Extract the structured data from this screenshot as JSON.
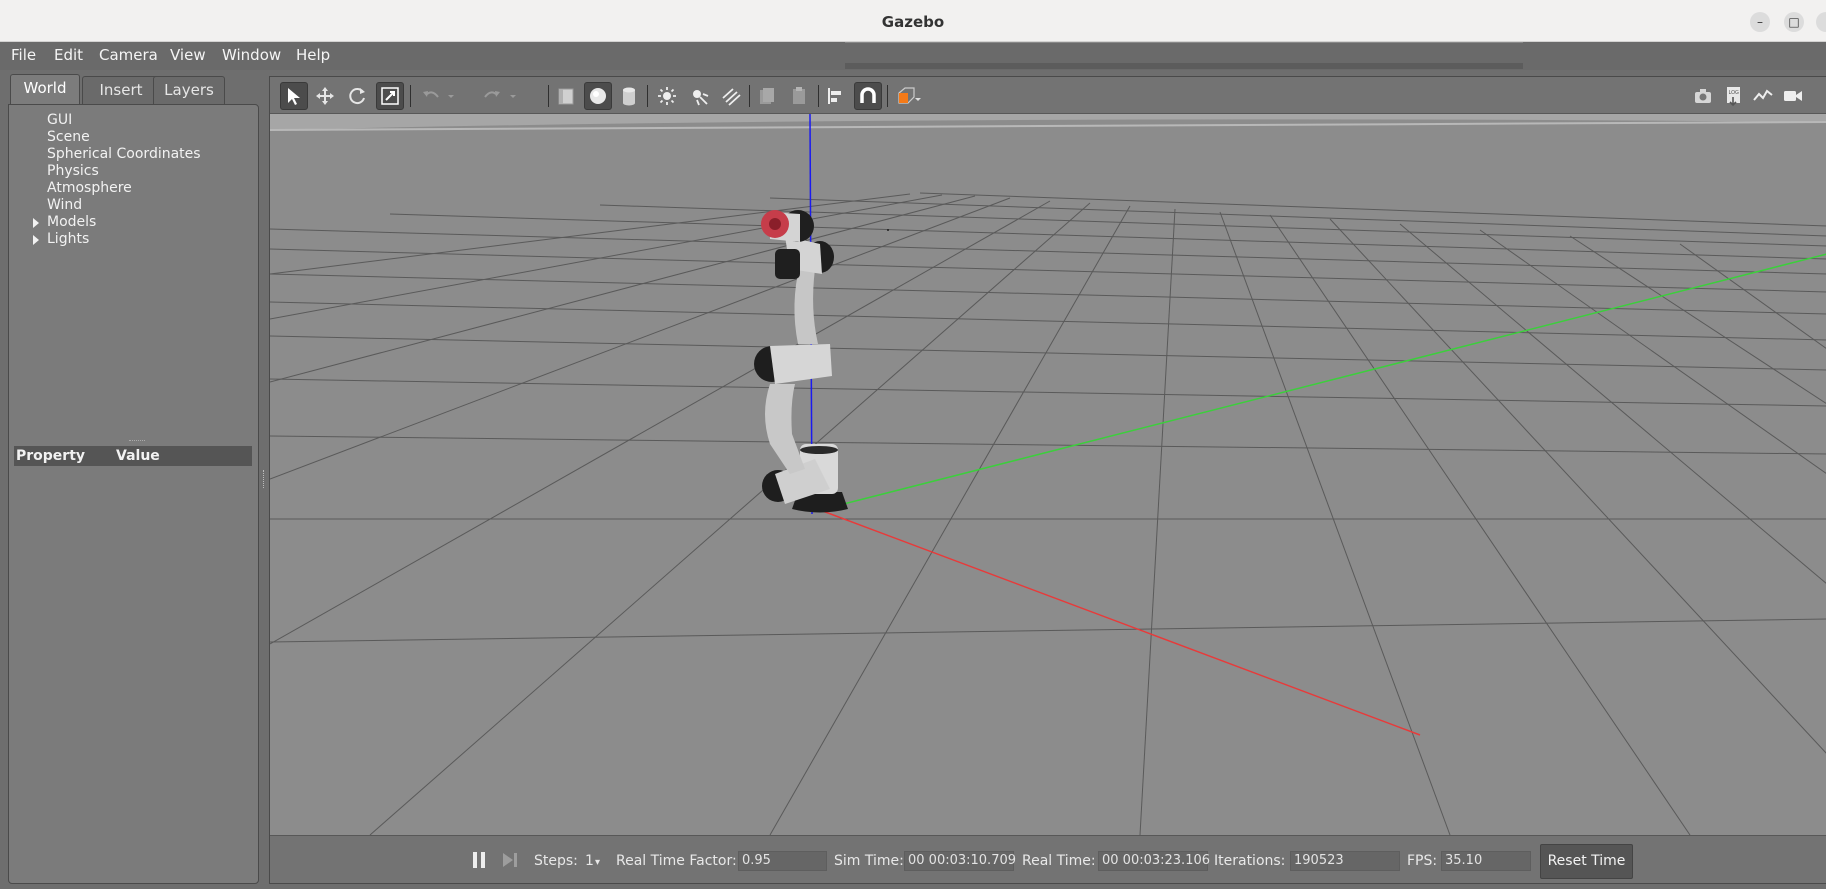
{
  "window": {
    "title": "Gazebo",
    "controls": {
      "minimize": "–",
      "maximize": "□"
    }
  },
  "menu": {
    "items": [
      {
        "label": "File"
      },
      {
        "label": "Edit"
      },
      {
        "label": "Camera"
      },
      {
        "label": "View"
      },
      {
        "label": "Window"
      },
      {
        "label": "Help"
      }
    ]
  },
  "left_panel": {
    "tabs": [
      {
        "label": "World",
        "active": true
      },
      {
        "label": "Insert"
      },
      {
        "label": "Layers"
      }
    ],
    "tree": [
      {
        "label": "GUI"
      },
      {
        "label": "Scene"
      },
      {
        "label": "Spherical Coordinates"
      },
      {
        "label": "Physics"
      },
      {
        "label": "Atmosphere"
      },
      {
        "label": "Wind"
      },
      {
        "label": "Models",
        "expandable": true
      },
      {
        "label": "Lights",
        "expandable": true
      }
    ],
    "property_header": {
      "property": "Property",
      "value": "Value"
    }
  },
  "toolbar": {
    "tools": [
      "select-mode",
      "translate-mode",
      "rotate-mode",
      "scale-mode",
      "undo",
      "undo-history",
      "redo",
      "redo-history",
      "box-shape",
      "sphere-shape",
      "cylinder-shape",
      "point-light",
      "spot-light",
      "directional-light",
      "copy",
      "paste",
      "align",
      "snap",
      "view-angle",
      "screenshot",
      "log",
      "plot",
      "record-video"
    ],
    "accent_color": "#f47a18"
  },
  "bottom_bar": {
    "steps_label": "Steps:",
    "steps_value": "1",
    "real_time_factor_label": "Real Time Factor:",
    "real_time_factor": "0.95",
    "sim_time_label": "Sim Time:",
    "sim_time": "00 00:03:10.709",
    "real_time_label": "Real Time:",
    "real_time": "00 00:03:23.106",
    "iterations_label": "Iterations:",
    "iterations": "190523",
    "fps_label": "FPS:",
    "fps": "35.10",
    "reset_label": "Reset Time"
  },
  "scene": {
    "axis_colors": {
      "x": "#ff3030",
      "y": "#38d038",
      "z": "#1010e8"
    },
    "ground_color": "#8c8c8c",
    "sky_color": "#a8a8a8"
  }
}
